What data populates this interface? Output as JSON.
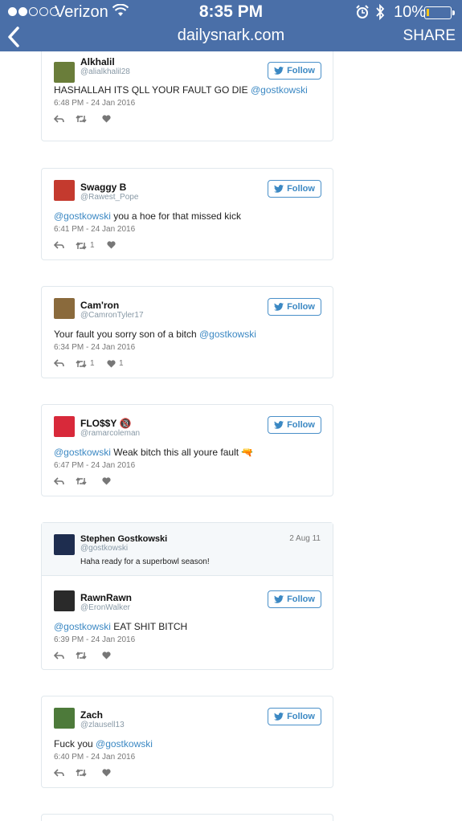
{
  "status_bar": {
    "carrier": "Verizon",
    "time": "8:35 PM",
    "battery": "10%",
    "battery_level": 0.1,
    "signal_dots": [
      true,
      true,
      false,
      false,
      false
    ]
  },
  "nav": {
    "domain": "dailysnark.com",
    "share_label": "SHARE"
  },
  "follow_label": "Follow",
  "tweets": [
    {
      "name": "Alkhalil",
      "handle": "@alialkhalil28",
      "text_before": "HASHALLAH ITS QLL YOUR FAULT GO DIE ",
      "mention": "@gostkowski",
      "text_after": "",
      "time": "6:48 PM - 24 Jan 2016",
      "retweets": "",
      "likes": "",
      "avatar_color": "#6a7d3a"
    },
    {
      "name": "Swaggy B",
      "handle": "@Rawest_Pope",
      "text_before": "",
      "mention": "@gostkowski",
      "text_after": " you a hoe for that missed kick",
      "time": "6:41 PM - 24 Jan 2016",
      "retweets": "1",
      "likes": "",
      "avatar_color": "#c43a2e"
    },
    {
      "name": "Cam'ron",
      "handle": "@CamronTyler17",
      "text_before": "Your fault you sorry son of a bitch ",
      "mention": "@gostkowski",
      "text_after": "",
      "time": "6:34 PM - 24 Jan 2016",
      "retweets": "1",
      "likes": "1",
      "avatar_color": "#8a6a3c"
    },
    {
      "name": "FLO$$Y",
      "name_emoji": "🔞",
      "handle": "@ramarcoleman",
      "text_before": "",
      "mention": "@gostkowski",
      "text_after": " Weak bitch this all youre fault ",
      "text_emoji": "🔫",
      "time": "6:47 PM - 24 Jan 2016",
      "retweets": "",
      "likes": "",
      "avatar_color": "#d8293a"
    },
    {
      "quoted": {
        "name": "Stephen Gostkowski",
        "handle": "@gostkowski",
        "date": "2 Aug 11",
        "text": "Haha ready for a superbowl season!",
        "avatar_color": "#1e2d4f"
      },
      "name": "RawnRawn",
      "handle": "@EronWalker",
      "text_before": "",
      "mention": "@gostkowski",
      "text_after": " EAT SHIT BITCH",
      "time": "6:39 PM - 24 Jan 2016",
      "retweets": "",
      "likes": "",
      "avatar_color": "#2a2a2a"
    },
    {
      "name": "Zach",
      "handle": "@zlausell13",
      "text_before": "Fuck you ",
      "mention": "@gostkowski",
      "text_after": "",
      "time": "6:40 PM - 24 Jan 2016",
      "retweets": "",
      "likes": "",
      "avatar_color": "#4d7a3a"
    }
  ],
  "icons": {
    "reply": "reply-icon",
    "retweet": "retweet-icon",
    "like": "heart-icon",
    "twitter_bird": "twitter-bird-icon"
  }
}
